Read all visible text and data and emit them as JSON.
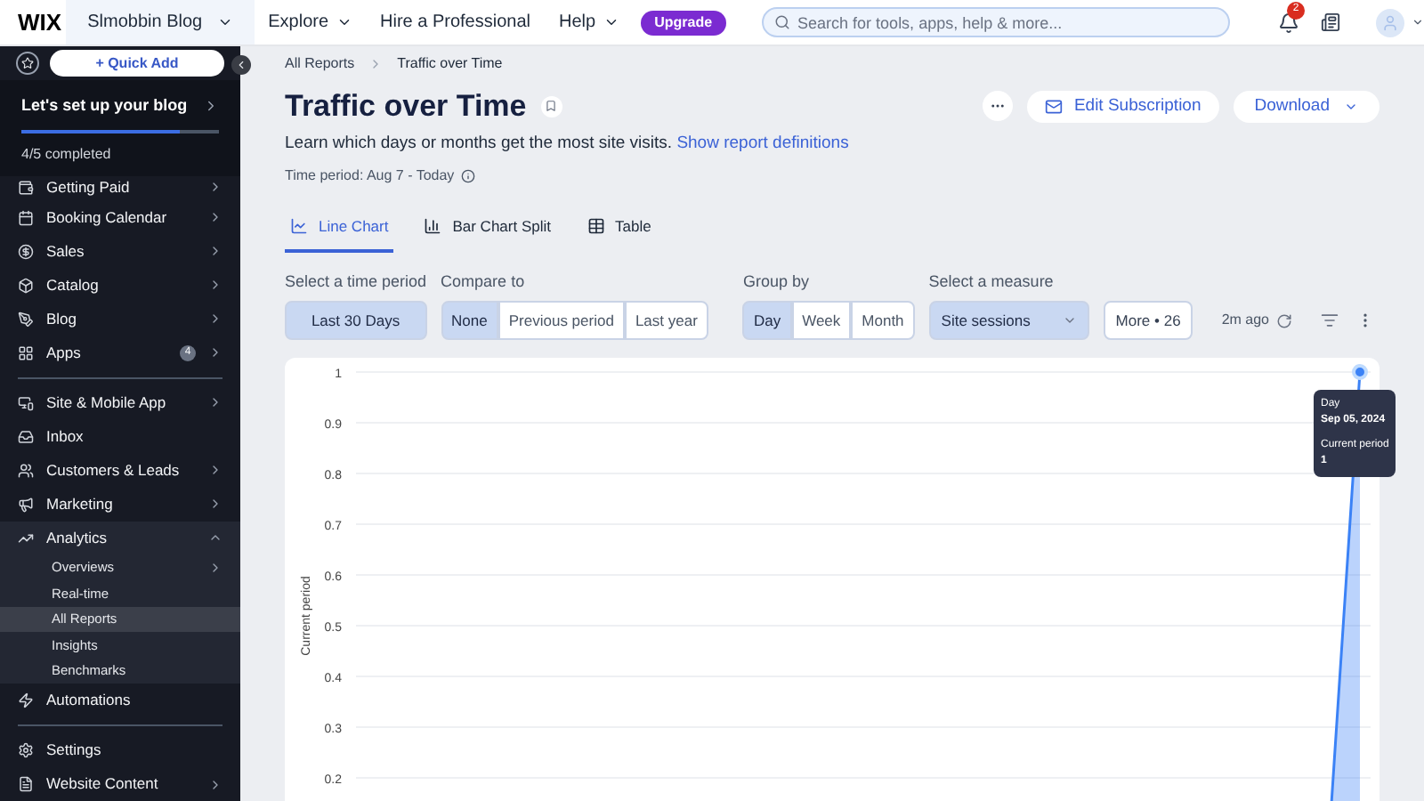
{
  "topbar": {
    "logo": "WIX",
    "site": "Slmobbin Blog",
    "menu": [
      "Explore",
      "Hire a Professional",
      "Help"
    ],
    "upgrade": "Upgrade",
    "search": {
      "placeholder": "Search for tools, apps, help & more..."
    },
    "notifications": "2"
  },
  "sidebar": {
    "quick_add": "+ Quick Add",
    "setup": {
      "title": "Let's set up your blog",
      "level": 0.8,
      "progress": "4/5 completed"
    },
    "sections": [
      {
        "items": [
          {
            "label": "Getting Paid",
            "chevron": true
          },
          {
            "label": "Booking Calendar",
            "chevron": true
          },
          {
            "label": "Sales",
            "chevron": true
          },
          {
            "label": "Catalog",
            "chevron": true
          },
          {
            "label": "Blog",
            "chevron": true
          },
          {
            "label": "Apps",
            "badge": "4",
            "chevron": true
          }
        ]
      },
      {
        "items": [
          {
            "label": "Site & Mobile App",
            "chevron": true
          },
          {
            "label": "Inbox",
            "chevron": false
          },
          {
            "label": "Customers & Leads",
            "chevron": true
          },
          {
            "label": "Marketing",
            "chevron": true
          },
          {
            "label": "Analytics",
            "chevron": true,
            "expanded": true,
            "children": [
              {
                "label": "Overviews",
                "chevron": true,
                "selected": false
              },
              {
                "label": "Real-time",
                "chevron": false,
                "selected": false
              },
              {
                "label": "All Reports",
                "chevron": false,
                "selected": true
              },
              {
                "label": "Insights",
                "chevron": false,
                "selected": false
              },
              {
                "label": "Benchmarks",
                "chevron": false,
                "selected": false
              }
            ]
          },
          {
            "label": "Automations",
            "chevron": false
          }
        ]
      },
      {
        "items": [
          {
            "label": "Settings",
            "chevron": false
          },
          {
            "label": "Website Content",
            "chevron": true
          }
        ]
      }
    ]
  },
  "breadcrumbs": [
    "All Reports",
    "Traffic over Time"
  ],
  "page": {
    "title": "Traffic over Time",
    "description": "Learn which days or months get the most site visits.",
    "link": "Show report definitions",
    "time_period": "Time period: Aug 7 - Today",
    "edit_subscription": "Edit Subscription",
    "download": "Download"
  },
  "tabs": [
    {
      "label": "Line Chart",
      "selected": true
    },
    {
      "label": "Bar Chart Split",
      "selected": false
    },
    {
      "label": "Table",
      "selected": false
    }
  ],
  "filters": {
    "time": {
      "label": "Select a time period",
      "value": "Last 30 Days"
    },
    "compare": {
      "label": "Compare to",
      "options": [
        {
          "label": "None",
          "selected": true
        },
        {
          "label": "Previous period",
          "selected": false
        },
        {
          "label": "Last year",
          "selected": false
        }
      ]
    },
    "group": {
      "label": "Group by",
      "options": [
        {
          "label": "Day",
          "selected": true
        },
        {
          "label": "Week",
          "selected": false
        },
        {
          "label": "Month",
          "selected": false
        }
      ]
    },
    "measure": {
      "label": "Select a measure",
      "value": "Site sessions"
    },
    "more": "More • 26",
    "updated": "2m ago"
  },
  "chart": {
    "tooltip": {
      "label": "Day",
      "date": "Sep 05, 2024",
      "value": "1"
    },
    "chart_data": {
      "type": "area",
      "ylabel": "Current period",
      "grid": true,
      "yticks": [
        0.2,
        0.3,
        0.4,
        0.5,
        0.6,
        0.7,
        0.8,
        0.9,
        1
      ],
      "ylim": [
        0,
        1
      ],
      "series": [
        {
          "name": "Current period",
          "color": "#3b82f6",
          "values": [
            0,
            0,
            0,
            0,
            0,
            0,
            0,
            0,
            0,
            0,
            0,
            0,
            0,
            0,
            0,
            0,
            0,
            0,
            0,
            0,
            0,
            0,
            0,
            0,
            0,
            0,
            0,
            0,
            0,
            0,
            1
          ]
        }
      ]
    }
  }
}
